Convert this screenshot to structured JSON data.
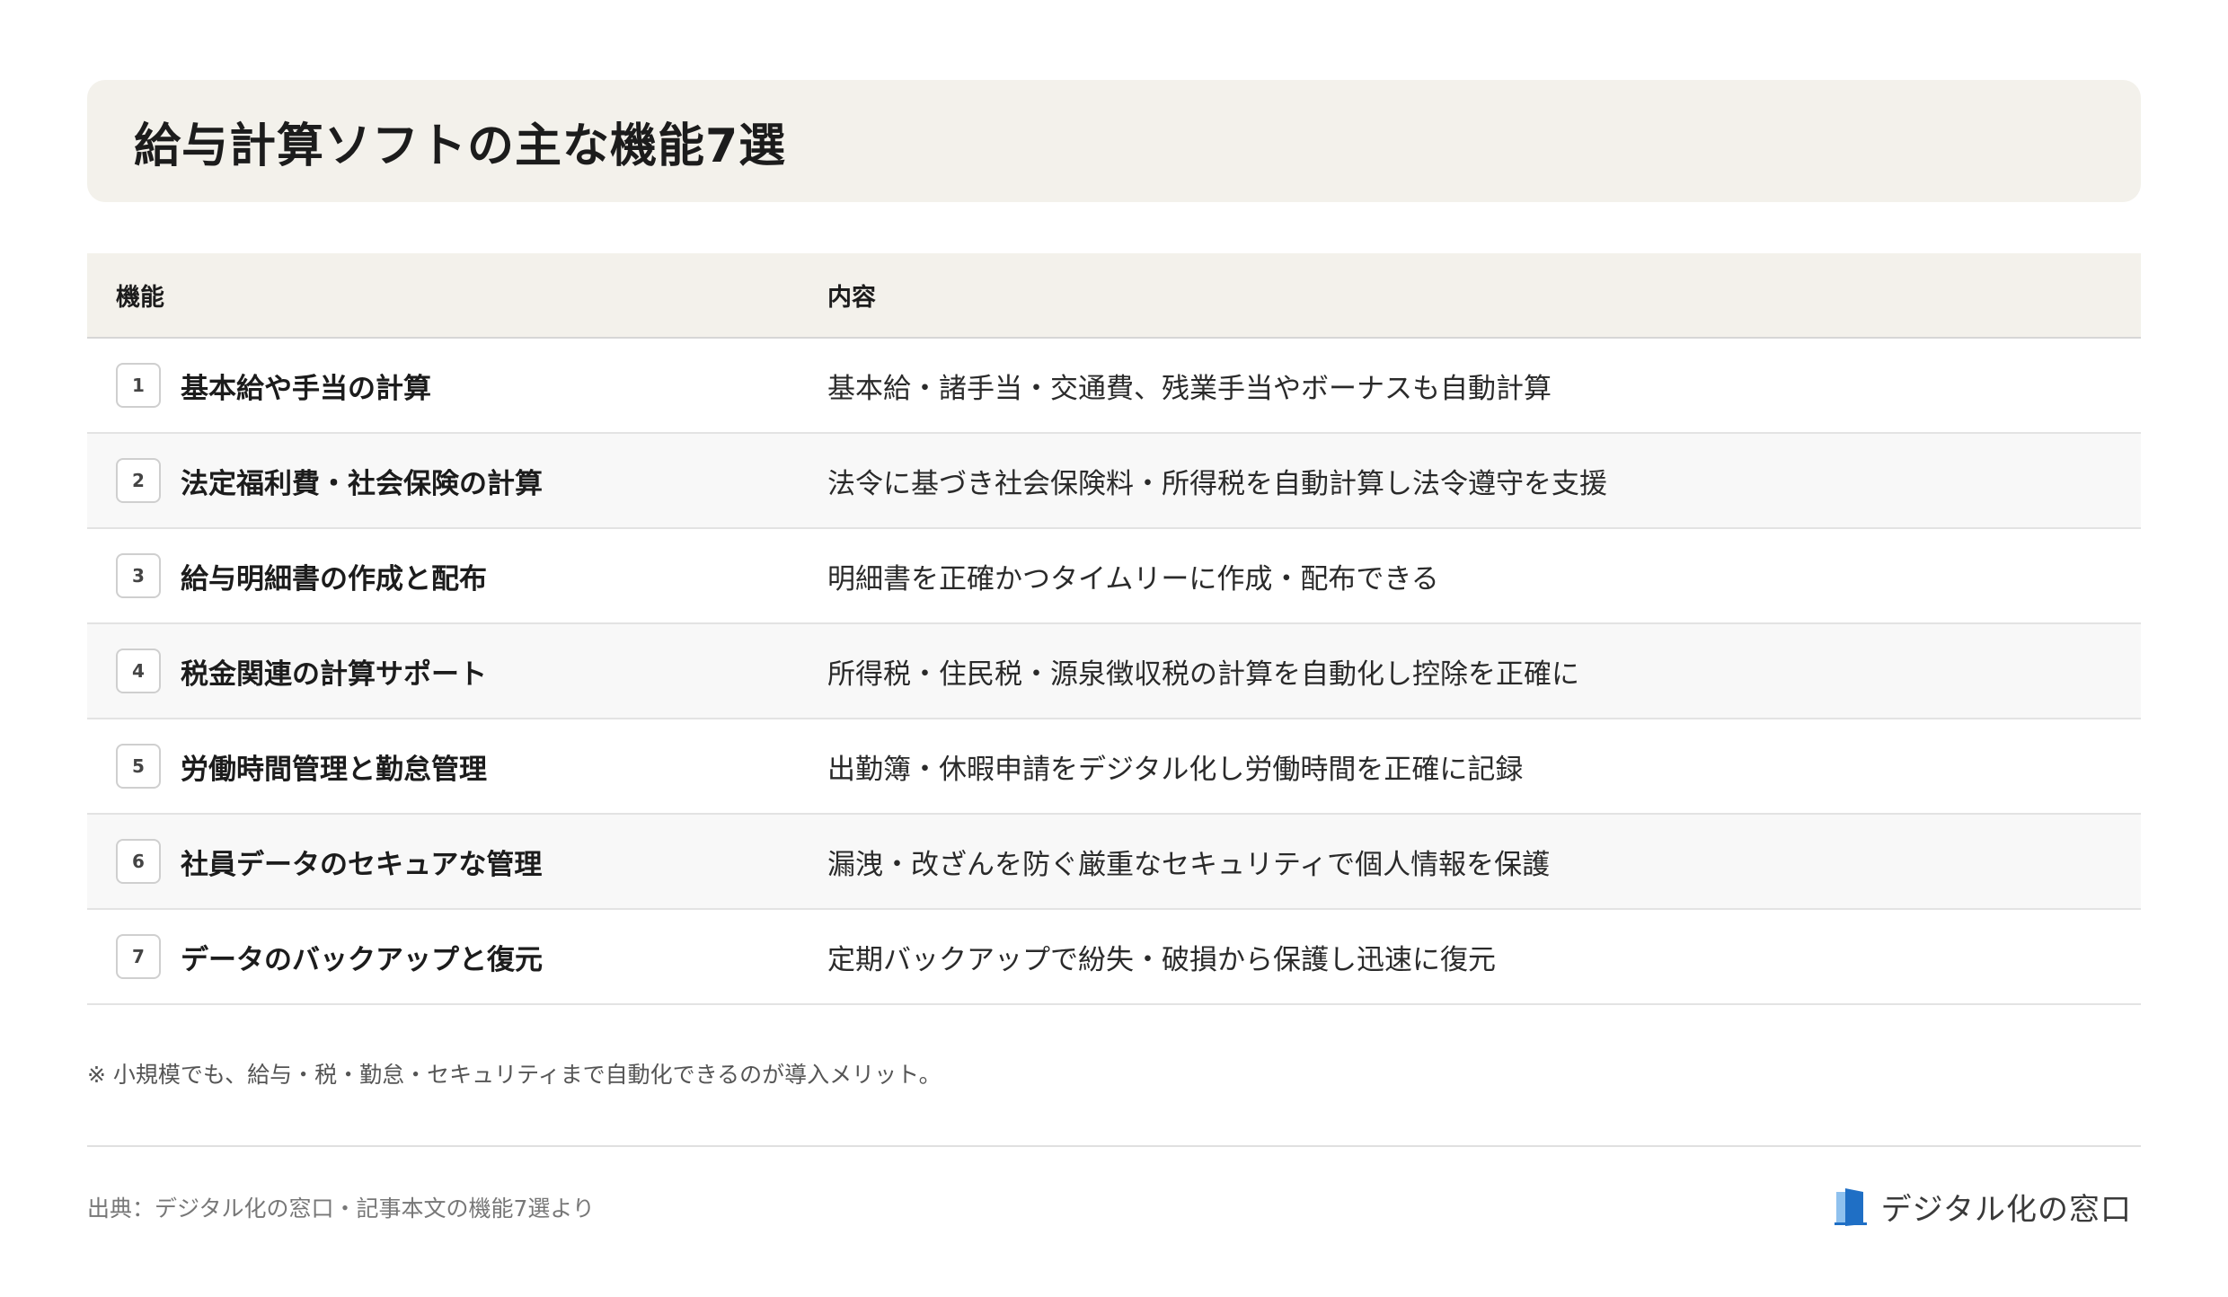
{
  "title": "給与計算ソフトの主な機能7選",
  "table": {
    "headers": {
      "feature": "機能",
      "content": "内容"
    },
    "rows": [
      {
        "num": "1",
        "feature": "基本給や手当の計算",
        "content": "基本給・諸手当・交通費、残業手当やボーナスも自動計算"
      },
      {
        "num": "2",
        "feature": "法定福利費・社会保険の計算",
        "content": "法令に基づき社会保険料・所得税を自動計算し法令遵守を支援"
      },
      {
        "num": "3",
        "feature": "給与明細書の作成と配布",
        "content": "明細書を正確かつタイムリーに作成・配布できる"
      },
      {
        "num": "4",
        "feature": "税金関連の計算サポート",
        "content": "所得税・住民税・源泉徴収税の計算を自動化し控除を正確に"
      },
      {
        "num": "5",
        "feature": "労働時間管理と勤怠管理",
        "content": "出勤簿・休暇申請をデジタル化し労働時間を正確に記録"
      },
      {
        "num": "6",
        "feature": "社員データのセキュアな管理",
        "content": "漏洩・改ざんを防ぐ厳重なセキュリティで個人情報を保護"
      },
      {
        "num": "7",
        "feature": "データのバックアップと復元",
        "content": "定期バックアップで紛失・破損から保護し迅速に復元"
      }
    ]
  },
  "note": "※ 小規模でも、給与・税・勤怠・セキュリティまで自動化できるのが導入メリット。",
  "footer": {
    "source": "出典：デジタル化の窓口・記事本文の機能7選より",
    "brand": "デジタル化の窓口",
    "brand_icon": "door-logo-icon",
    "brand_color": "#1f6fc5"
  }
}
